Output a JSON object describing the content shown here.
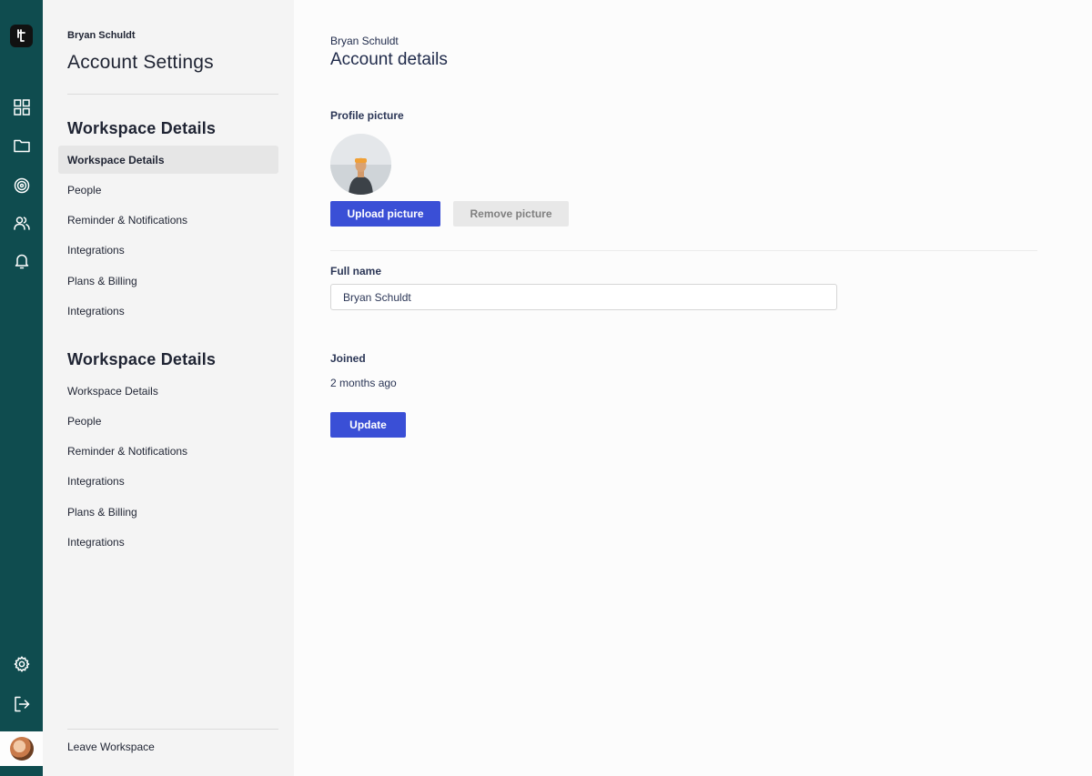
{
  "rail": {
    "icons": [
      "logo-icon",
      "grid-icon",
      "folder-icon",
      "target-icon",
      "users-icon",
      "bell-icon",
      "gear-icon",
      "logout-icon"
    ]
  },
  "sidebar": {
    "user_name": "Bryan Schuldt",
    "title": "Account Settings",
    "sections": [
      {
        "heading": "Workspace Details",
        "items": [
          {
            "label": "Workspace Details",
            "active": true
          },
          {
            "label": "People"
          },
          {
            "label": "Reminder & Notifications"
          },
          {
            "label": "Integrations"
          },
          {
            "label": "Plans & Billing"
          },
          {
            "label": "Integrations"
          }
        ]
      },
      {
        "heading": "Workspace Details",
        "items": [
          {
            "label": "Workspace Details"
          },
          {
            "label": "People"
          },
          {
            "label": "Reminder & Notifications"
          },
          {
            "label": "Integrations"
          },
          {
            "label": "Plans & Billing"
          },
          {
            "label": "Integrations"
          }
        ]
      }
    ],
    "leave_label": "Leave Workspace"
  },
  "main": {
    "user_name": "Bryan Schuldt",
    "title": "Account details",
    "profile_picture_label": "Profile picture",
    "upload_label": "Upload picture",
    "remove_label": "Remove picture",
    "full_name_label": "Full name",
    "full_name_value": "Bryan Schuldt",
    "joined_label": "Joined",
    "joined_value": "2 months ago",
    "update_label": "Update"
  },
  "colors": {
    "rail": "#0f4c4f",
    "primary_button": "#3a4fd6",
    "secondary_button": "#e8e8e8"
  }
}
